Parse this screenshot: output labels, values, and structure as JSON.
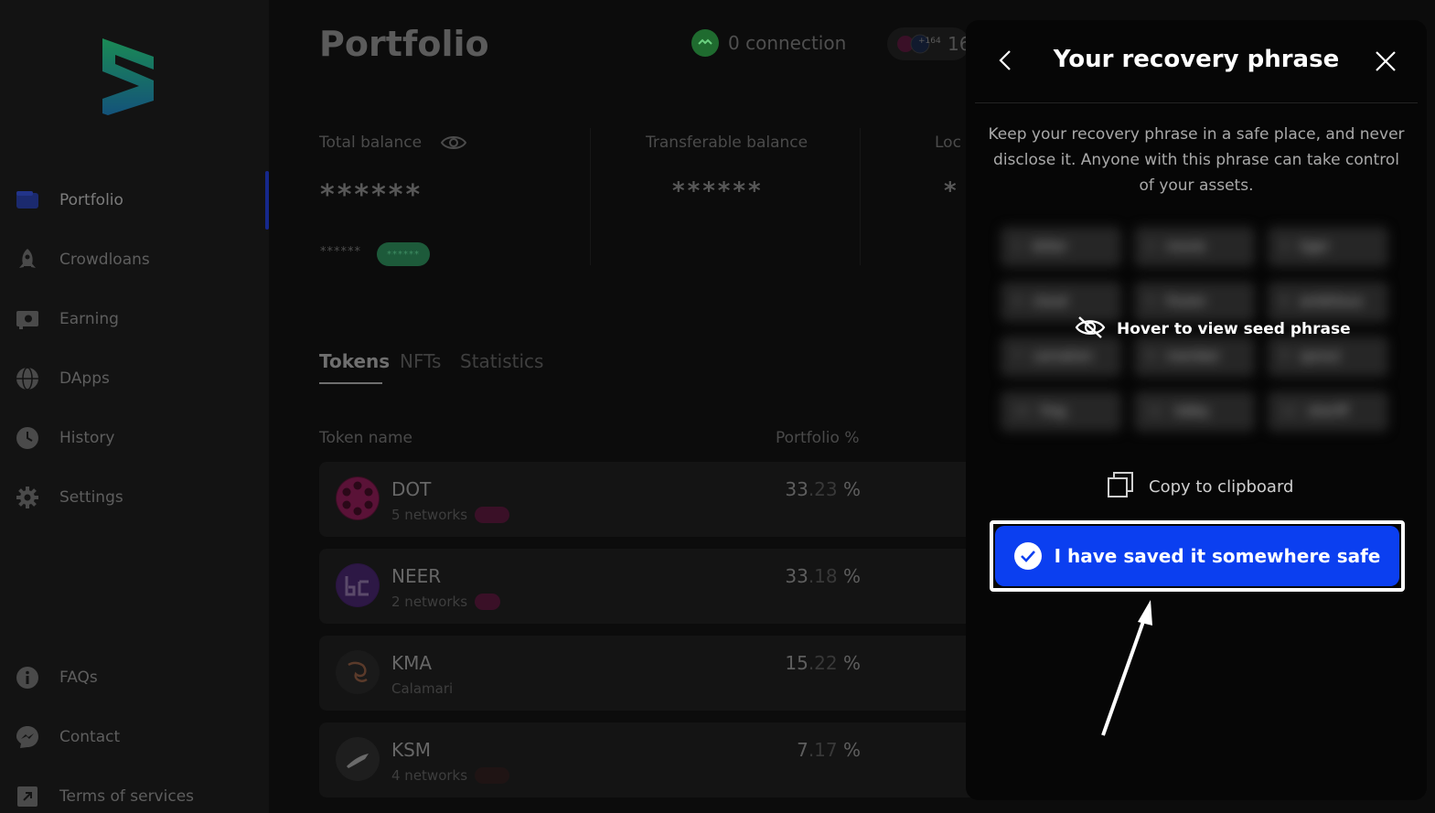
{
  "sidebar": {
    "items": [
      {
        "label": "Portfolio",
        "icon": "wallet-icon"
      },
      {
        "label": "Crowdloans",
        "icon": "rocket-icon"
      },
      {
        "label": "Earning",
        "icon": "earning-icon"
      },
      {
        "label": "DApps",
        "icon": "globe-icon"
      },
      {
        "label": "History",
        "icon": "clock-icon"
      },
      {
        "label": "Settings",
        "icon": "gear-icon"
      }
    ],
    "bottom_items": [
      {
        "label": "FAQs",
        "icon": "info-icon"
      },
      {
        "label": "Contact",
        "icon": "messenger-icon"
      },
      {
        "label": "Terms of services",
        "icon": "external-link-icon"
      }
    ]
  },
  "header": {
    "title": "Portfolio",
    "connection_label": "0 connection",
    "network_badge": "+164",
    "network_count": "16"
  },
  "balances": {
    "total_label": "Total balance",
    "total_value": "******",
    "total_sub_value": "******",
    "total_change_pill": "******",
    "transferable_label": "Transferable balance",
    "transferable_value": "******",
    "locked_label": "Loc",
    "locked_value": "*"
  },
  "tabs": [
    {
      "label": "Tokens",
      "active": true
    },
    {
      "label": "NFTs",
      "active": false
    },
    {
      "label": "Statistics",
      "active": false
    }
  ],
  "table": {
    "col_token": "Token name",
    "col_portfolio": "Portfolio %",
    "rows": [
      {
        "name": "DOT",
        "sub": "5 networks",
        "pct_int": "33",
        "pct_dec": ".23",
        "pct_sign": "%",
        "icon": "polkadot-icon"
      },
      {
        "name": "NEER",
        "sub": "2 networks",
        "pct_int": "33",
        "pct_dec": ".18",
        "pct_sign": "%",
        "icon": "neer-icon"
      },
      {
        "name": "KMA",
        "sub": "Calamari",
        "pct_int": "15",
        "pct_dec": ".22",
        "pct_sign": "%",
        "icon": "calamari-icon"
      },
      {
        "name": "KSM",
        "sub": "4 networks",
        "pct_int": "7",
        "pct_dec": ".17",
        "pct_sign": "%",
        "icon": "kusama-icon"
      }
    ]
  },
  "panel": {
    "title": "Your recovery phrase",
    "description": "Keep your recovery phrase in a safe place, and never disclose it. Anyone with this phrase can take control of your assets.",
    "seed_words": [
      {
        "n": "1",
        "w": "bitter"
      },
      {
        "n": "2",
        "w": "movie"
      },
      {
        "n": "3",
        "w": "tiger"
      },
      {
        "n": "4",
        "w": "cloud"
      },
      {
        "n": "5",
        "w": "frozen"
      },
      {
        "n": "6",
        "w": "ambitious"
      },
      {
        "n": "7",
        "w": "carnation"
      },
      {
        "n": "8",
        "w": "member"
      },
      {
        "n": "9",
        "w": "sprout"
      },
      {
        "n": "10",
        "w": "frog"
      },
      {
        "n": "11",
        "w": "lobby"
      },
      {
        "n": "12",
        "w": "sheriff"
      }
    ],
    "hover_hint": "Hover to view seed phrase",
    "copy_label": "Copy to clipboard",
    "save_label": "I have saved it somewhere safe"
  },
  "colors": {
    "accent": "#0b3ff0",
    "panel_bg": "#060606",
    "connection_green": "#1f6b2f"
  }
}
